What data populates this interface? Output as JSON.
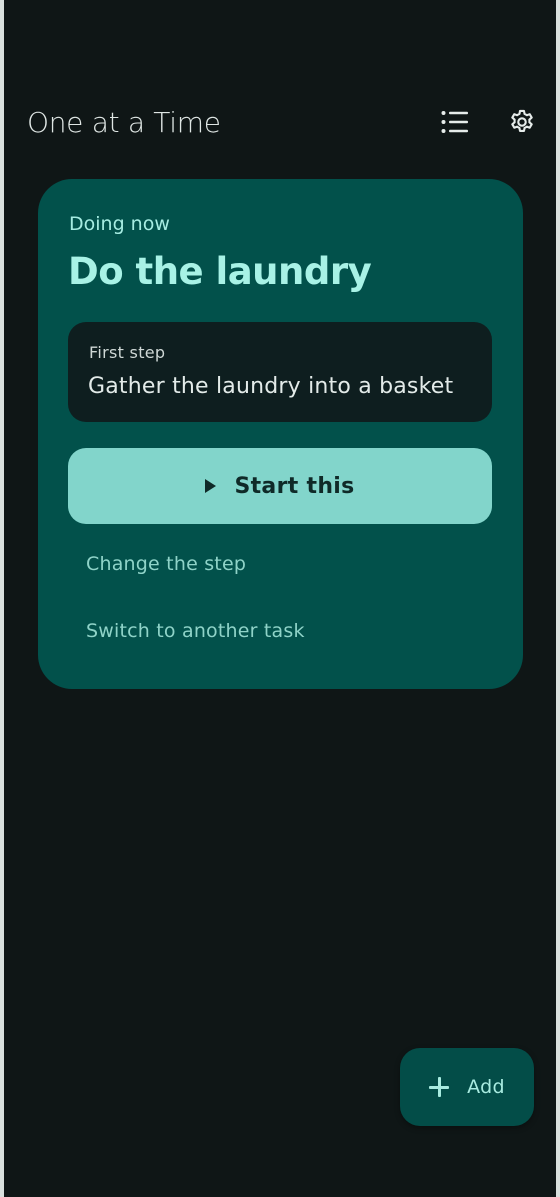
{
  "app": {
    "title": "One at a Time"
  },
  "toolbar": {
    "list_icon": "list-icon",
    "settings_icon": "gear-icon"
  },
  "current_task": {
    "status_label": "Doing now",
    "title": "Do the laundry",
    "step": {
      "label": "First step",
      "text": "Gather the laundry into a basket"
    },
    "start_button": {
      "icon": "play-icon",
      "label": "Start this"
    },
    "change_step_label": "Change the step",
    "switch_task_label": "Switch to another task"
  },
  "fab": {
    "icon": "plus-icon",
    "label": "Add"
  },
  "colors": {
    "background": "#0f1616",
    "card": "#02514b",
    "accent": "#82d5cb",
    "title_text": "#a8f2e6"
  }
}
